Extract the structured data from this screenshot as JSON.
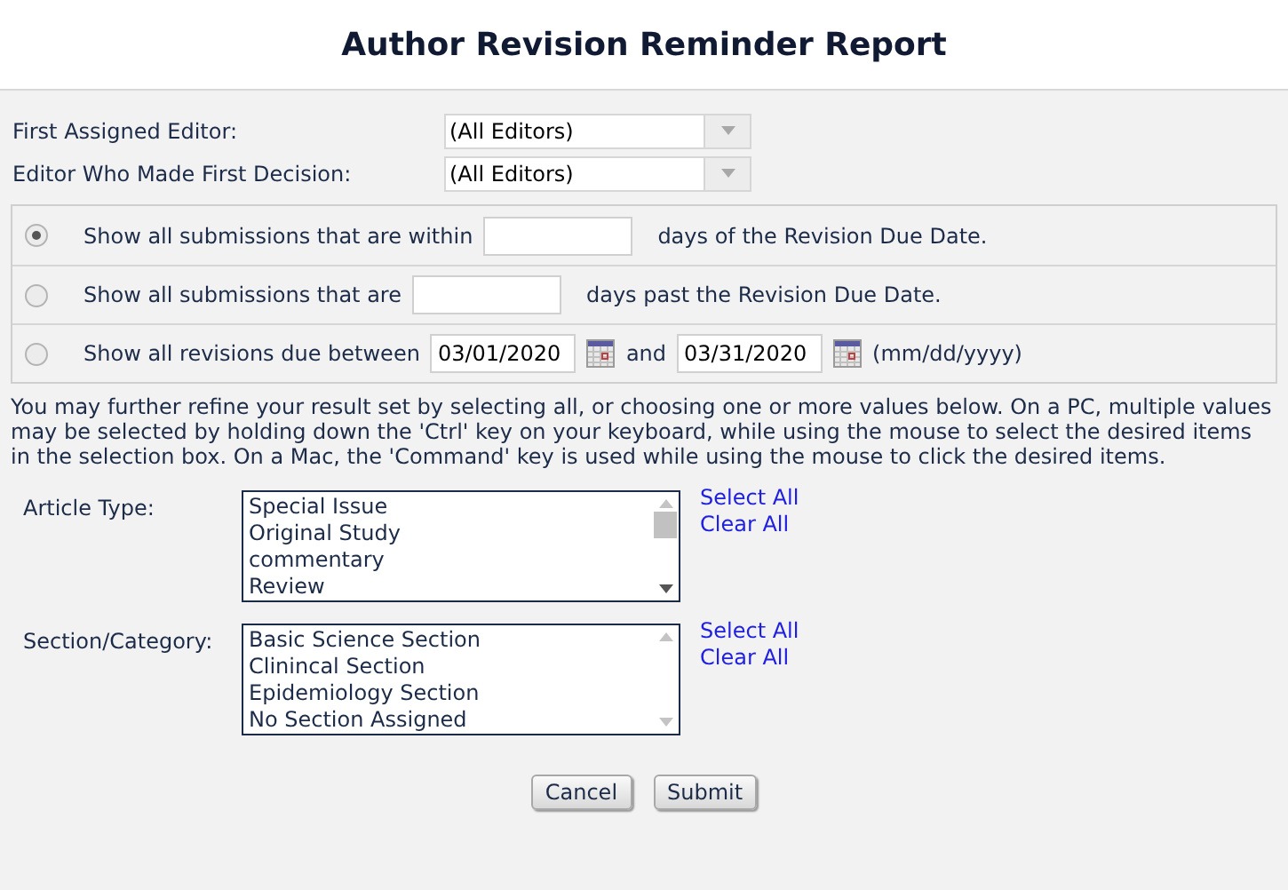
{
  "title": "Author Revision Reminder Report",
  "editor_filters": [
    {
      "label": "First Assigned Editor:",
      "value": "(All Editors)"
    },
    {
      "label": "Editor Who Made First Decision:",
      "value": "(All Editors)"
    }
  ],
  "date_options": [
    {
      "selected": true,
      "parts": [
        {
          "kind": "text",
          "text": "Show all submissions that are within"
        },
        {
          "kind": "input"
        },
        {
          "kind": "text",
          "text": "days of the Revision Due Date."
        }
      ]
    },
    {
      "selected": false,
      "parts": [
        {
          "kind": "text",
          "text": "Show all submissions that are"
        },
        {
          "kind": "input"
        },
        {
          "kind": "text",
          "text": "days past the Revision Due Date."
        }
      ]
    },
    {
      "selected": false,
      "parts": [
        {
          "kind": "text",
          "text": "Show all revisions due between"
        },
        {
          "kind": "date",
          "value": "03/01/2020"
        },
        {
          "kind": "text",
          "text": "and"
        },
        {
          "kind": "date",
          "value": "03/31/2020"
        },
        {
          "kind": "text",
          "text": "(mm/dd/yyyy)"
        }
      ]
    }
  ],
  "instructions": "You may further refine your result set by selecting all, or choosing one or more values below. On a PC, multiple values may be selected by holding down the 'Ctrl' key on your keyboard, while using the mouse to select the desired items in the selection box. On a Mac, the 'Command' key is used while using the mouse to click the desired items.",
  "list_filters": [
    {
      "label": "Article Type:",
      "items": [
        "Special Issue",
        "Original Study",
        "commentary",
        "Review"
      ],
      "select_all": "Select All",
      "clear_all": "Clear All"
    },
    {
      "label": "Section/Category:",
      "items": [
        "Basic Science Section",
        "Clinincal Section",
        "Epidemiology Section",
        "No Section Assigned"
      ],
      "select_all": "Select All",
      "clear_all": "Clear All"
    }
  ],
  "buttons": [
    "Cancel",
    "Submit"
  ]
}
